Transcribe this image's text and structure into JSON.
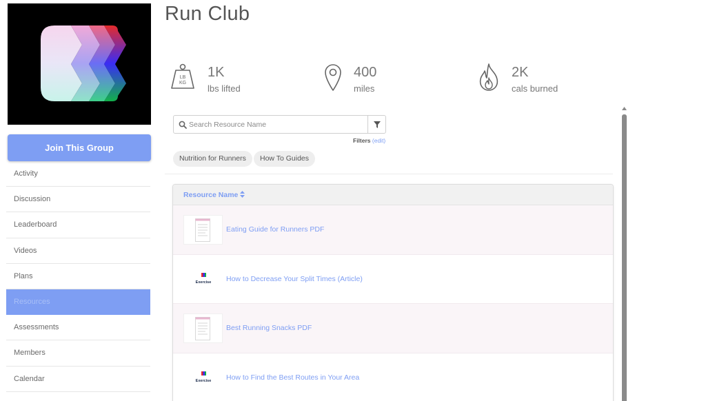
{
  "group": {
    "title": "Run Club",
    "join_label": "Join This Group",
    "brand_colors": [
      "#e52b2b",
      "#3a2cf5",
      "#1ab54c",
      "#b8f0e9"
    ]
  },
  "nav": {
    "items": [
      {
        "label": "Activity",
        "active": false
      },
      {
        "label": "Discussion",
        "active": false
      },
      {
        "label": "Leaderboard",
        "active": false
      },
      {
        "label": "Videos",
        "active": false
      },
      {
        "label": "Plans",
        "active": false
      },
      {
        "label": "Resources",
        "active": true
      },
      {
        "label": "Assessments",
        "active": false
      },
      {
        "label": "Members",
        "active": false
      },
      {
        "label": "Calendar",
        "active": false
      }
    ]
  },
  "stats": [
    {
      "icon": "weight-icon",
      "value": "1K",
      "label": "lbs lifted",
      "weight_text_top": "LB",
      "weight_text_bottom": "KG"
    },
    {
      "icon": "map-pin-icon",
      "value": "400",
      "label": "miles"
    },
    {
      "icon": "flame-icon",
      "value": "2K",
      "label": "cals burned"
    }
  ],
  "search": {
    "placeholder": "Search Resource Name",
    "filters_label": "Filters",
    "filters_edit": "(edit)"
  },
  "chips": [
    {
      "label": "Nutrition for Runners"
    },
    {
      "label": "How To Guides"
    }
  ],
  "table": {
    "header": "Resource Name",
    "rows": [
      {
        "name": "Eating Guide for Runners PDF",
        "thumb": "document-icon"
      },
      {
        "name": "How to Decrease Your Split Times (Article)",
        "thumb": "exercise-icon",
        "thumb_text": "Exercise"
      },
      {
        "name": "Best Running Snacks PDF",
        "thumb": "document-icon"
      },
      {
        "name": "How to Find the Best Routes in Your Area",
        "thumb": "exercise-icon",
        "thumb_text": "Exercise"
      }
    ]
  },
  "colors": {
    "accent": "#7e9ef3",
    "active_nav_text": "#a8bff7",
    "row_alt": "#faf5f8"
  }
}
